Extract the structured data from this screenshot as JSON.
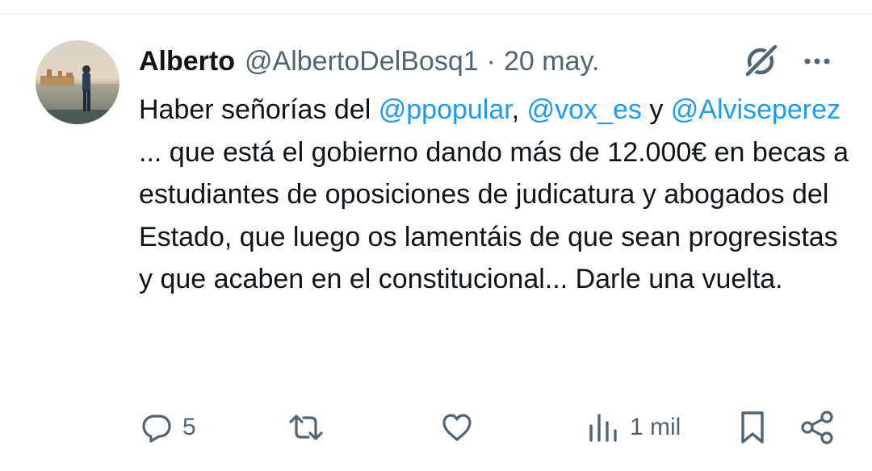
{
  "tweet": {
    "author": {
      "display_name": "Alberto",
      "handle": "@AlbertoDelBosq1"
    },
    "separator": "·",
    "date": "20 may.",
    "text_segments": [
      {
        "text": "Haber señorías del ",
        "mention": false
      },
      {
        "text": "@ppopular",
        "mention": true
      },
      {
        "text": ", ",
        "mention": false
      },
      {
        "text": "@vox_es",
        "mention": true
      },
      {
        "text": " y ",
        "mention": false
      },
      {
        "text": "@Alviseperez",
        "mention": true
      },
      {
        "text": " ... que está el gobierno dando más de 12.000€ en becas a estudiantes de oposiciones de judicatura y abogados del Estado, que luego os lamentáis de que sean progresistas y que acaben en el constitucional... Darle una vuelta.",
        "mention": false
      }
    ],
    "actions": {
      "reply_count": "5",
      "retweet_count": "",
      "like_count": "",
      "views_count": "1 mil"
    }
  },
  "icons": {
    "grok": "grok-icon",
    "more": "more-icon",
    "reply": "reply-icon",
    "retweet": "retweet-icon",
    "like": "like-icon",
    "views": "views-icon",
    "bookmark": "bookmark-icon",
    "share": "share-icon"
  },
  "colors": {
    "text": "#0f1419",
    "secondary": "#536471",
    "mention": "#1d9bf0",
    "divider": "#eff3f4"
  }
}
